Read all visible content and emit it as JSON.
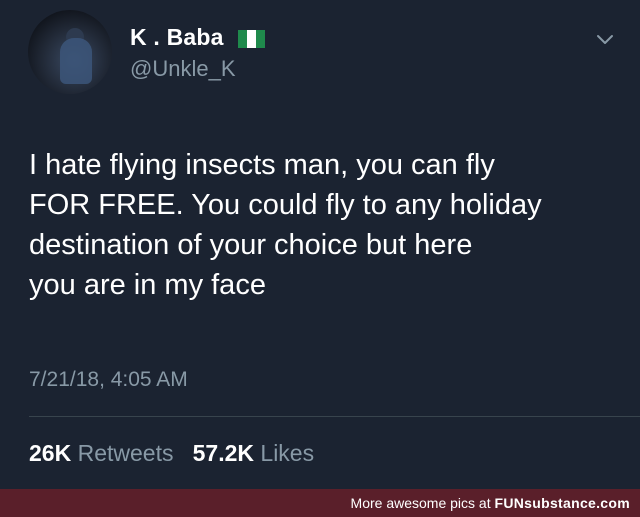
{
  "user": {
    "name": "K . Baba",
    "handle": "@Unkle_K",
    "flag_icon": "nigeria-flag-icon"
  },
  "tweet": {
    "lines": [
      "I hate flying insects man, you can fly",
      "FOR FREE. You could fly to any holiday",
      "destination of your choice but here",
      "you are in my face"
    ],
    "timestamp": "7/21/18, 4:05 AM"
  },
  "stats": {
    "retweets_count": "26K",
    "retweets_label": "Retweets",
    "likes_count": "57.2K",
    "likes_label": "Likes"
  },
  "watermark": {
    "prefix": "More awesome pics at",
    "brand": "FUNsubstance.com"
  },
  "colors": {
    "background": "#1b2331",
    "secondary_text": "#8899a6",
    "footer_bg": "#5a1f2a"
  }
}
